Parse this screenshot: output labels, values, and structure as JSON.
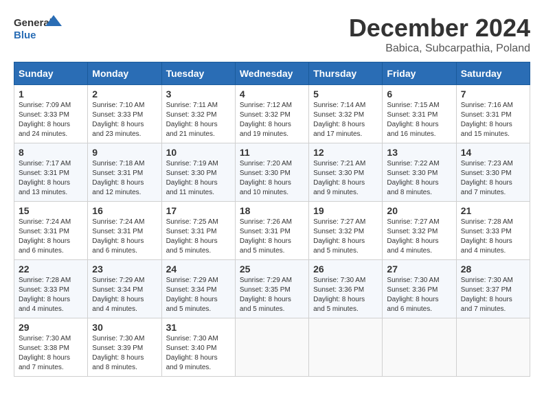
{
  "header": {
    "logo_general": "General",
    "logo_blue": "Blue",
    "month_title": "December 2024",
    "location": "Babica, Subcarpathia, Poland"
  },
  "days_of_week": [
    "Sunday",
    "Monday",
    "Tuesday",
    "Wednesday",
    "Thursday",
    "Friday",
    "Saturday"
  ],
  "weeks": [
    [
      {
        "day": "1",
        "sunrise": "7:09 AM",
        "sunset": "3:33 PM",
        "daylight": "8 hours and 24 minutes."
      },
      {
        "day": "2",
        "sunrise": "7:10 AM",
        "sunset": "3:33 PM",
        "daylight": "8 hours and 23 minutes."
      },
      {
        "day": "3",
        "sunrise": "7:11 AM",
        "sunset": "3:32 PM",
        "daylight": "8 hours and 21 minutes."
      },
      {
        "day": "4",
        "sunrise": "7:12 AM",
        "sunset": "3:32 PM",
        "daylight": "8 hours and 19 minutes."
      },
      {
        "day": "5",
        "sunrise": "7:14 AM",
        "sunset": "3:32 PM",
        "daylight": "8 hours and 17 minutes."
      },
      {
        "day": "6",
        "sunrise": "7:15 AM",
        "sunset": "3:31 PM",
        "daylight": "8 hours and 16 minutes."
      },
      {
        "day": "7",
        "sunrise": "7:16 AM",
        "sunset": "3:31 PM",
        "daylight": "8 hours and 15 minutes."
      }
    ],
    [
      {
        "day": "8",
        "sunrise": "7:17 AM",
        "sunset": "3:31 PM",
        "daylight": "8 hours and 13 minutes."
      },
      {
        "day": "9",
        "sunrise": "7:18 AM",
        "sunset": "3:31 PM",
        "daylight": "8 hours and 12 minutes."
      },
      {
        "day": "10",
        "sunrise": "7:19 AM",
        "sunset": "3:30 PM",
        "daylight": "8 hours and 11 minutes."
      },
      {
        "day": "11",
        "sunrise": "7:20 AM",
        "sunset": "3:30 PM",
        "daylight": "8 hours and 10 minutes."
      },
      {
        "day": "12",
        "sunrise": "7:21 AM",
        "sunset": "3:30 PM",
        "daylight": "8 hours and 9 minutes."
      },
      {
        "day": "13",
        "sunrise": "7:22 AM",
        "sunset": "3:30 PM",
        "daylight": "8 hours and 8 minutes."
      },
      {
        "day": "14",
        "sunrise": "7:23 AM",
        "sunset": "3:30 PM",
        "daylight": "8 hours and 7 minutes."
      }
    ],
    [
      {
        "day": "15",
        "sunrise": "7:24 AM",
        "sunset": "3:31 PM",
        "daylight": "8 hours and 6 minutes."
      },
      {
        "day": "16",
        "sunrise": "7:24 AM",
        "sunset": "3:31 PM",
        "daylight": "8 hours and 6 minutes."
      },
      {
        "day": "17",
        "sunrise": "7:25 AM",
        "sunset": "3:31 PM",
        "daylight": "8 hours and 5 minutes."
      },
      {
        "day": "18",
        "sunrise": "7:26 AM",
        "sunset": "3:31 PM",
        "daylight": "8 hours and 5 minutes."
      },
      {
        "day": "19",
        "sunrise": "7:27 AM",
        "sunset": "3:32 PM",
        "daylight": "8 hours and 5 minutes."
      },
      {
        "day": "20",
        "sunrise": "7:27 AM",
        "sunset": "3:32 PM",
        "daylight": "8 hours and 4 minutes."
      },
      {
        "day": "21",
        "sunrise": "7:28 AM",
        "sunset": "3:33 PM",
        "daylight": "8 hours and 4 minutes."
      }
    ],
    [
      {
        "day": "22",
        "sunrise": "7:28 AM",
        "sunset": "3:33 PM",
        "daylight": "8 hours and 4 minutes."
      },
      {
        "day": "23",
        "sunrise": "7:29 AM",
        "sunset": "3:34 PM",
        "daylight": "8 hours and 4 minutes."
      },
      {
        "day": "24",
        "sunrise": "7:29 AM",
        "sunset": "3:34 PM",
        "daylight": "8 hours and 5 minutes."
      },
      {
        "day": "25",
        "sunrise": "7:29 AM",
        "sunset": "3:35 PM",
        "daylight": "8 hours and 5 minutes."
      },
      {
        "day": "26",
        "sunrise": "7:30 AM",
        "sunset": "3:36 PM",
        "daylight": "8 hours and 5 minutes."
      },
      {
        "day": "27",
        "sunrise": "7:30 AM",
        "sunset": "3:36 PM",
        "daylight": "8 hours and 6 minutes."
      },
      {
        "day": "28",
        "sunrise": "7:30 AM",
        "sunset": "3:37 PM",
        "daylight": "8 hours and 7 minutes."
      }
    ],
    [
      {
        "day": "29",
        "sunrise": "7:30 AM",
        "sunset": "3:38 PM",
        "daylight": "8 hours and 7 minutes."
      },
      {
        "day": "30",
        "sunrise": "7:30 AM",
        "sunset": "3:39 PM",
        "daylight": "8 hours and 8 minutes."
      },
      {
        "day": "31",
        "sunrise": "7:30 AM",
        "sunset": "3:40 PM",
        "daylight": "8 hours and 9 minutes."
      },
      null,
      null,
      null,
      null
    ]
  ],
  "labels": {
    "sunrise": "Sunrise:",
    "sunset": "Sunset:",
    "daylight": "Daylight:"
  }
}
